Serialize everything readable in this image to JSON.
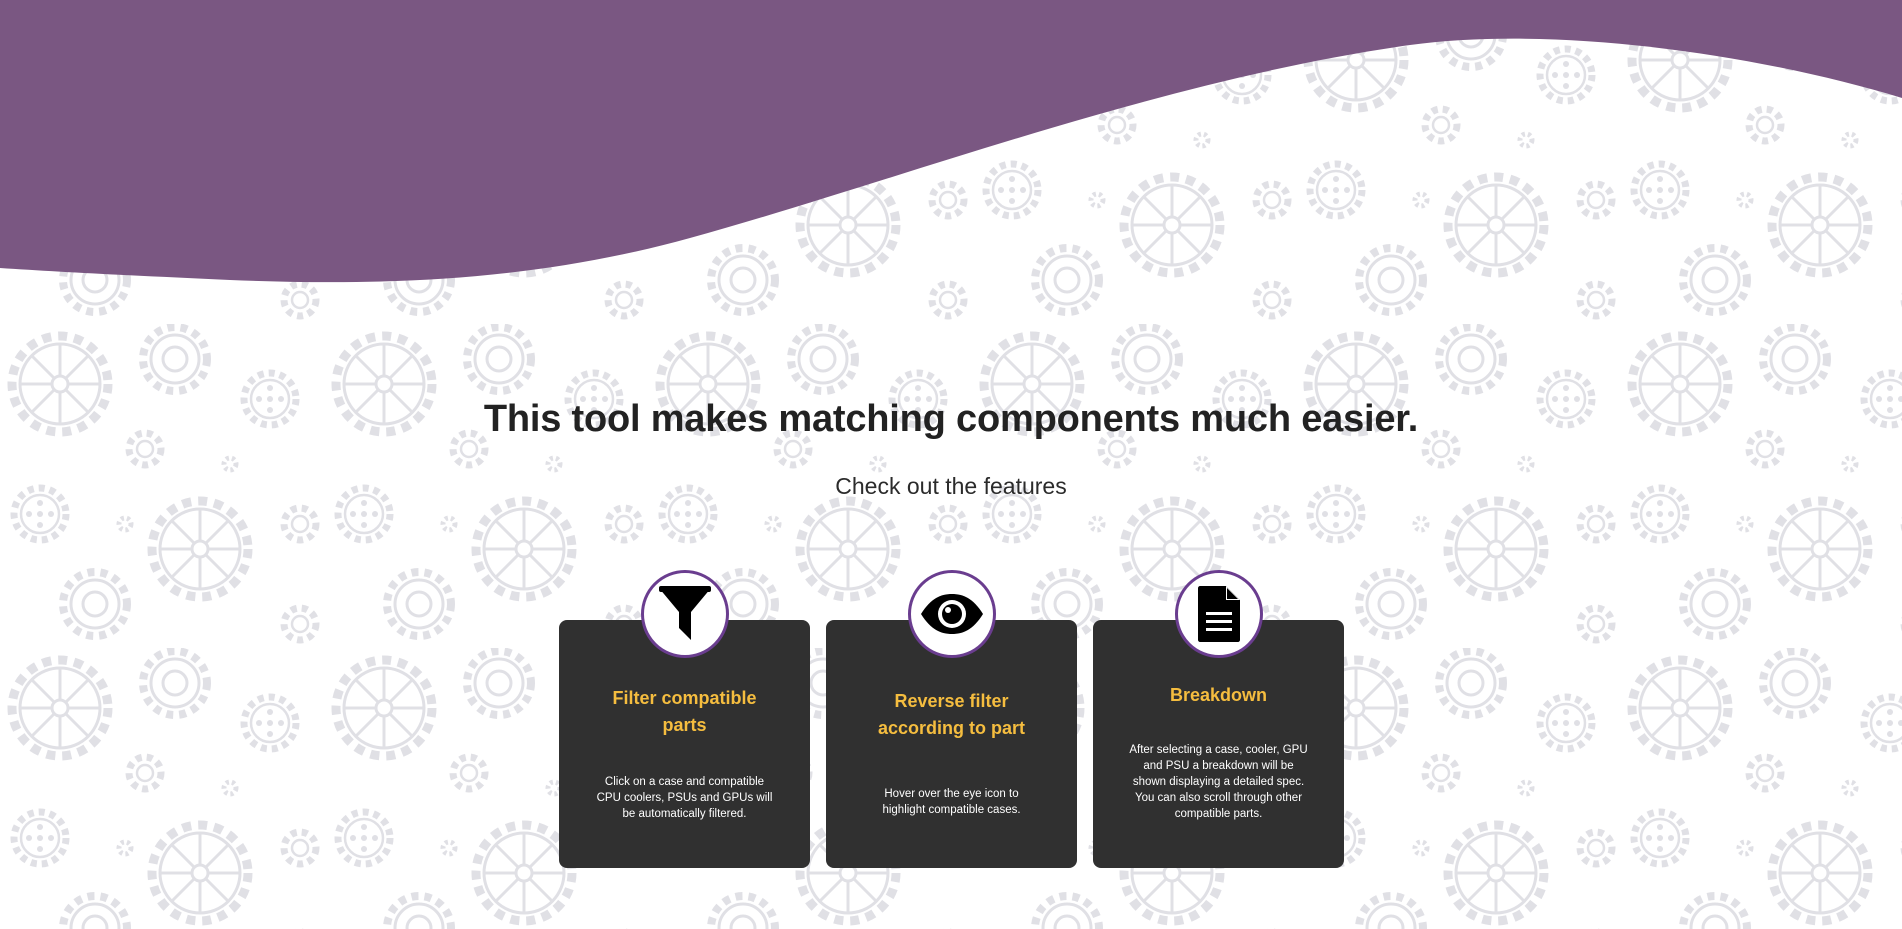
{
  "hero": {
    "headline": "This tool makes matching components much easier.",
    "subheadline": "Check out the features"
  },
  "features": [
    {
      "icon": "filter-icon",
      "title": "Filter compatible parts",
      "text": "Click on a case and compatible CPU coolers, PSUs and GPUs will be automatically filtered."
    },
    {
      "icon": "eye-icon",
      "title": "Reverse filter according to part",
      "text": "Hover over the eye icon to highlight compatible cases."
    },
    {
      "icon": "document-icon",
      "title": "Breakdown",
      "text": "After selecting a case, cooler, GPU and PSU a breakdown will be shown displaying a detailed spec. You can also scroll through other compatible parts."
    }
  ],
  "colors": {
    "accent_purple": "#7a5782",
    "card_background": "#303030",
    "card_title": "#f5bd3f",
    "icon_ring": "#6a3d8f",
    "gear_pattern": "#e2e2e6"
  }
}
